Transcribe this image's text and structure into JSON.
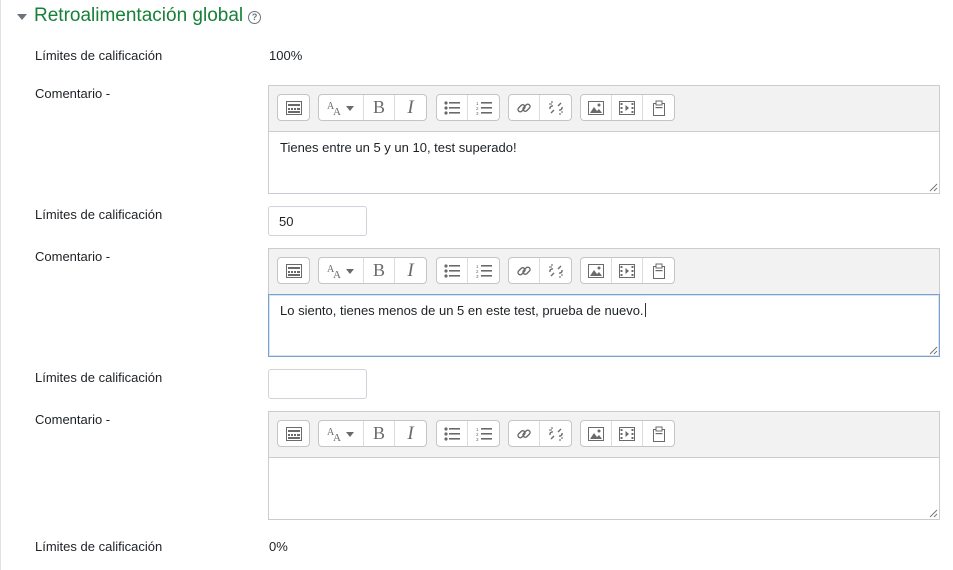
{
  "section": {
    "title": "Retroalimentación global"
  },
  "rows": [
    {
      "label": "Límites de calificación",
      "value": "100%"
    },
    {
      "label": "Comentario -",
      "text": "Tienes entre un 5 y un 10, test superado!"
    },
    {
      "label": "Límites de calificación",
      "input_value": "50"
    },
    {
      "label": "Comentario -",
      "text": "Lo siento, tienes menos de un 5 en este test, prueba de nuevo."
    },
    {
      "label": "Límites de calificación",
      "input_value": ""
    },
    {
      "label": "Comentario -",
      "text": ""
    },
    {
      "label": "Límites de calificación",
      "value": "0%"
    }
  ],
  "toolbar": {
    "bold_glyph": "B",
    "italic_glyph": "I",
    "icons": [
      "toolbar-toggle-icon",
      "font-style-icon",
      "bold-icon",
      "italic-icon",
      "bullet-list-icon",
      "numbered-list-icon",
      "link-icon",
      "unlink-icon",
      "image-icon",
      "media-icon",
      "manage-files-icon"
    ]
  },
  "colors": {
    "title": "#188038",
    "focus_border": "#7aa2cc",
    "toolbar_bg": "#f2f2f2"
  }
}
